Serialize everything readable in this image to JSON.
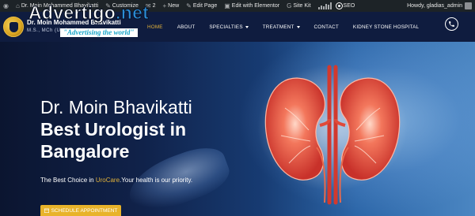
{
  "adminbar": {
    "wp_icon": "wordpress-icon",
    "site_name": "Dr. Moin Mohammed Bhavikatti",
    "customize": "Customize",
    "comments_count": "2",
    "new_label": "New",
    "edit_page": "Edit Page",
    "edit_elementor": "Edit with Elementor",
    "site_kit": "Site Kit",
    "seo": "SEO",
    "howdy": "Howdy, gladias_admin"
  },
  "watermark": {
    "name_part": "Advertigo",
    "domain_part": ".net",
    "tagline": "\"Advertising the world\""
  },
  "header": {
    "logo_text": "Dr. Moin Mohammed Bhavikatti",
    "logo_sub": "M.S., MCh (Urology)"
  },
  "nav": {
    "items": [
      {
        "label": "HOME",
        "active": true
      },
      {
        "label": "ABOUT"
      },
      {
        "label": "SPECIALTIES"
      },
      {
        "label": "TREATMENT"
      },
      {
        "label": "CONTACT"
      },
      {
        "label": "KIDNEY STONE HOSPITAL"
      }
    ],
    "phone_icon": "phone-icon"
  },
  "hero": {
    "title_line1": "Dr. Moin Bhavikatti",
    "title_line2": "Best Urologist in",
    "title_line3": "Bangalore",
    "tagline_prefix": "The Best Choice in ",
    "tagline_highlight": "UroCare",
    "tagline_suffix": ".Your health is our priority.",
    "cta_label": "SCHEDULE APPOINTMENT",
    "cta_icon": "calendar-icon"
  },
  "colors": {
    "navy": "#0f1c3f",
    "gold": "#e8b32a",
    "admin_bar": "#1d2327",
    "kidney": "#e8503a"
  }
}
